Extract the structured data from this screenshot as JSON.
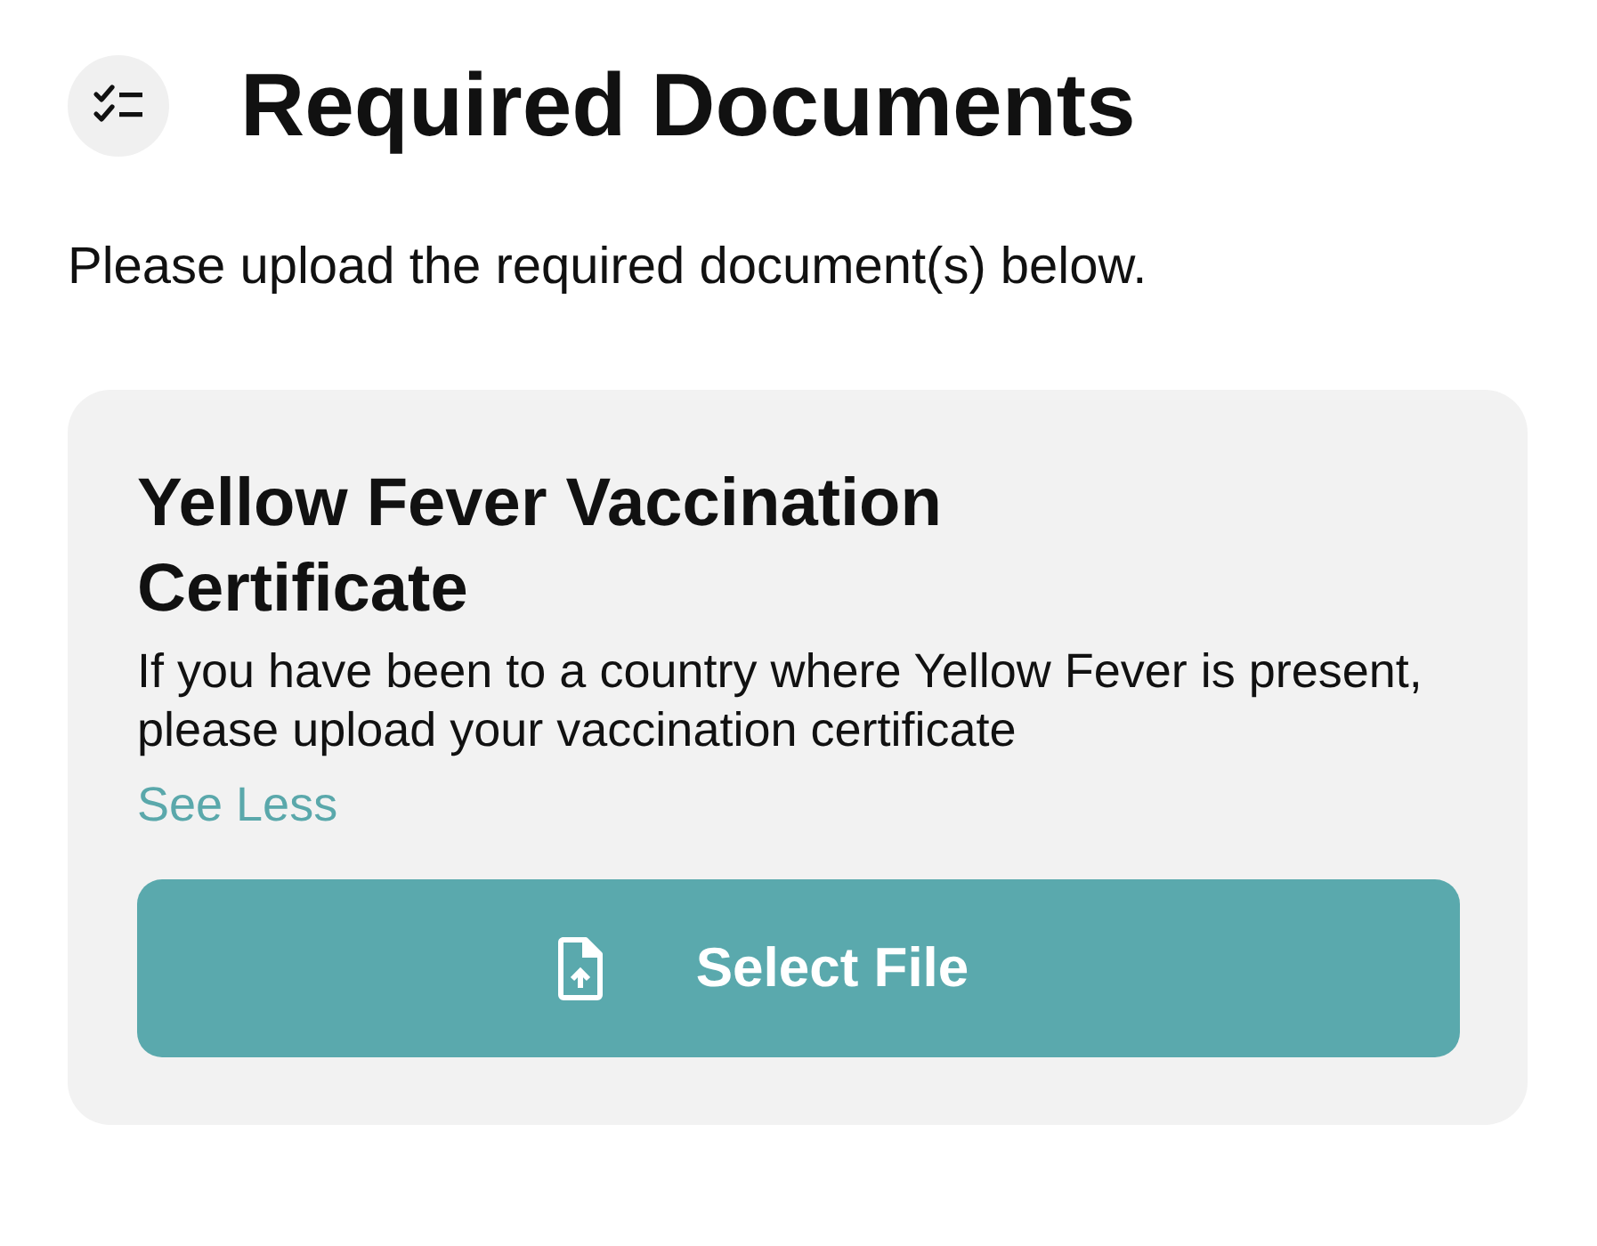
{
  "header": {
    "title": "Required Documents"
  },
  "intro": "Please upload the required document(s) below.",
  "documents": [
    {
      "title": "Yellow Fever Vaccination Certificate",
      "description": "If you have been to a country where Yellow Fever is present, please upload your vaccination certificate",
      "toggle_link": "See Less",
      "button": "Select File"
    }
  ]
}
